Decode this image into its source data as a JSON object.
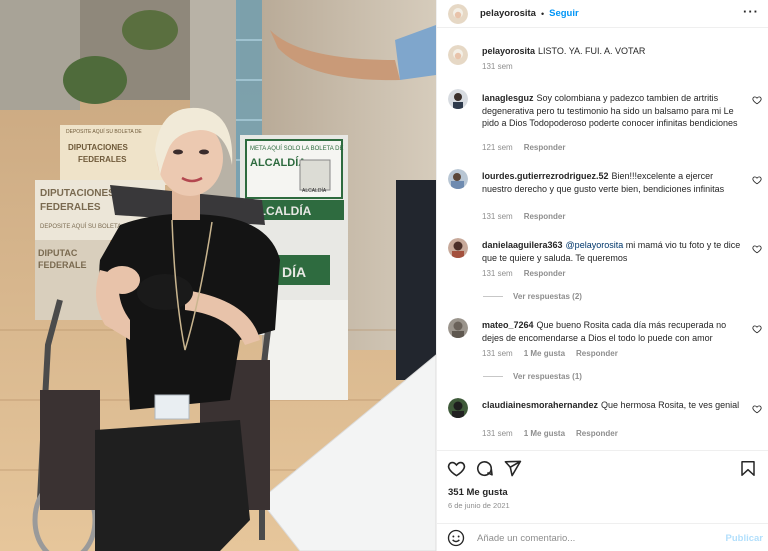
{
  "post": {
    "username": "pelayorosita",
    "follow_label": "Seguir",
    "more_icon": "more-horizontal-icon",
    "caption": {
      "username": "pelayorosita",
      "text": "LISTO. YA. FUI. A. VOTAR",
      "time": "131 sem"
    }
  },
  "photo": {
    "sign_alcaldia_1": "META AQUÍ SOLO LA BOLETA DE",
    "sign_alcaldia_2": "ALCALDÍA",
    "sign_alcaldia_small": "ALCALDÍA",
    "sign_alcaldia_3": "ALCALDÍA",
    "sign_dip_1": "DEPOSITE AQUÍ SU BOLETA DE",
    "sign_dip_2": "DIPUTACIONES",
    "sign_dip_3": "FEDERALES",
    "sign_dip_4": "DIPUTACIONES",
    "sign_dip_5": "FEDERALES",
    "sign_dip_6": "DEPOSITE AQUÍ SU BOLETA",
    "sign_dip_7": "DIPUTAC",
    "sign_dip_8": "FEDERALE",
    "sign_dia": "DÍA"
  },
  "comments": [
    {
      "username": "lanaglesguz",
      "text": "Soy colombiana y padezco tambien de artritis degenerativa pero tu testimonio ha sido un balsamo para mi Le pido a Dios Todopoderoso poderte conocer infinitas bendiciones",
      "time": "121 sem",
      "reply_label": "Responder"
    },
    {
      "username": "lourdes.gutierrezrodriguez.52",
      "text": "Bien!!!excelente a ejercer nuestro derecho y que gusto verte bien, bendiciones infinitas",
      "time": "131 sem",
      "reply_label": "Responder"
    },
    {
      "username": "danielaaguilera363",
      "mention": "@pelayorosita",
      "text": "mi mamá vio tu foto y te dice que te quiere y saluda. Te queremos",
      "time": "131 sem",
      "reply_label": "Responder",
      "view_replies": "Ver respuestas (2)"
    },
    {
      "username": "mateo_7264",
      "text": "Que bueno Rosita cada día más recuperada no dejes de encomendarse a Dios el todo lo puede con amor",
      "time": "131 sem",
      "likes": "1 Me gusta",
      "reply_label": "Responder",
      "view_replies": "Ver respuestas (1)"
    },
    {
      "username": "claudiainesmorahernandez",
      "text": "Que hermosa Rosita, te ves genial",
      "time": "131 sem",
      "likes": "1 Me gusta",
      "reply_label": "Responder"
    }
  ],
  "actions": {
    "like_icon": "heart-icon",
    "comment_icon": "comment-icon",
    "share_icon": "paper-plane-icon",
    "save_icon": "bookmark-icon",
    "likes_count": "351 Me gusta",
    "date": "6 de junio de 2021"
  },
  "add_comment": {
    "emoji_icon": "emoji-icon",
    "placeholder": "Añade un comentario...",
    "publish_label": "Publicar"
  },
  "colors": {
    "link_blue": "#0095f6",
    "publish_disabled": "#b2dffc",
    "muted_text": "#8e8e8e",
    "text": "#262626"
  }
}
